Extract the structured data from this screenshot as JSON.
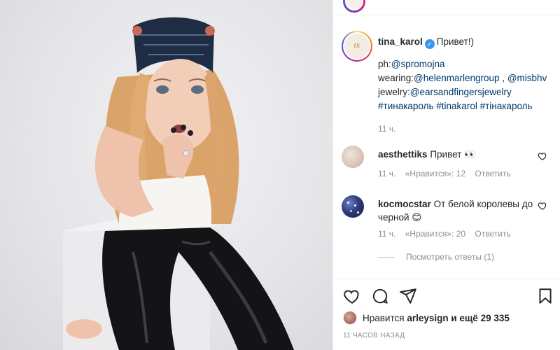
{
  "post": {
    "author": "tina_karol",
    "header_author_partial": "tina_karol",
    "caption_text": "Привет!)",
    "caption_lines": {
      "ph_prefix": "ph:",
      "ph_handle": "@spromojna",
      "wearing_prefix": "wearing:",
      "wearing_handle1": "@helenmarlengroup",
      "wearing_sep": " , ",
      "wearing_handle2": "@misbhv",
      "jewelry_prefix": "jewelry:",
      "jewelry_handle": "@earsandfingersjewelry",
      "hashtags": "#тинакароль #tinakarol #тінакароль"
    },
    "caption_time": "11 ч.",
    "avatar_text": "tk",
    "verified_glyph": "✓"
  },
  "comments": [
    {
      "username": "aesthettiks",
      "text": "Привет 👀",
      "time": "11 ч.",
      "likes": "«Нравится»: 12",
      "reply_label": "Ответить"
    },
    {
      "username": "kocmocstar",
      "text": "От белой королевы до черной 😊",
      "time": "11 ч.",
      "likes": "«Нравится»: 20",
      "reply_label": "Ответить",
      "view_replies": "Посмотреть ответы (1)"
    }
  ],
  "likes_summary": {
    "prefix": "Нравится ",
    "user": "arleysign",
    "suffix": " и ещё 29 335"
  },
  "posted_ago": "11 ЧАСОВ НАЗАД",
  "icons": [
    "heart-icon",
    "comment-icon",
    "share-icon",
    "bookmark-icon",
    "heart-small-icon",
    "verified-badge-icon"
  ],
  "colors": {
    "link": "#00376b",
    "verified": "#3897f0",
    "meta": "#8e8e8e",
    "text": "#262626"
  }
}
